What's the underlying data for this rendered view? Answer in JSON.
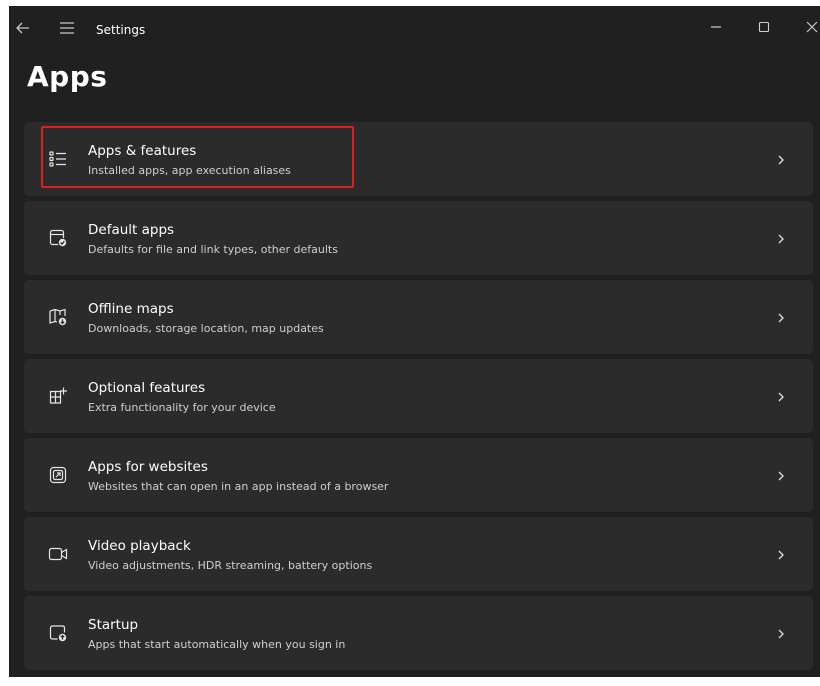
{
  "window": {
    "title": "Settings"
  },
  "page": {
    "title": "Apps"
  },
  "items": [
    {
      "title": "Apps & features",
      "description": "Installed apps, app execution aliases",
      "icon": "apps-features-list-icon",
      "highlighted": true
    },
    {
      "title": "Default apps",
      "description": "Defaults for file and link types, other defaults",
      "icon": "default-apps-icon"
    },
    {
      "title": "Offline maps",
      "description": "Downloads, storage location, map updates",
      "icon": "offline-maps-icon"
    },
    {
      "title": "Optional features",
      "description": "Extra functionality for your device",
      "icon": "optional-features-icon"
    },
    {
      "title": "Apps for websites",
      "description": "Websites that can open in an app instead of a browser",
      "icon": "apps-for-websites-icon"
    },
    {
      "title": "Video playback",
      "description": "Video adjustments, HDR streaming, battery options",
      "icon": "video-camera-icon"
    },
    {
      "title": "Startup",
      "description": "Apps that start automatically when you sign in",
      "icon": "startup-icon"
    }
  ],
  "colors": {
    "window_background": "#202020",
    "card_background": "#2b2b2b",
    "highlight_border": "#e0201c",
    "text_primary": "#ffffff",
    "text_secondary": "#cfcfcf"
  }
}
